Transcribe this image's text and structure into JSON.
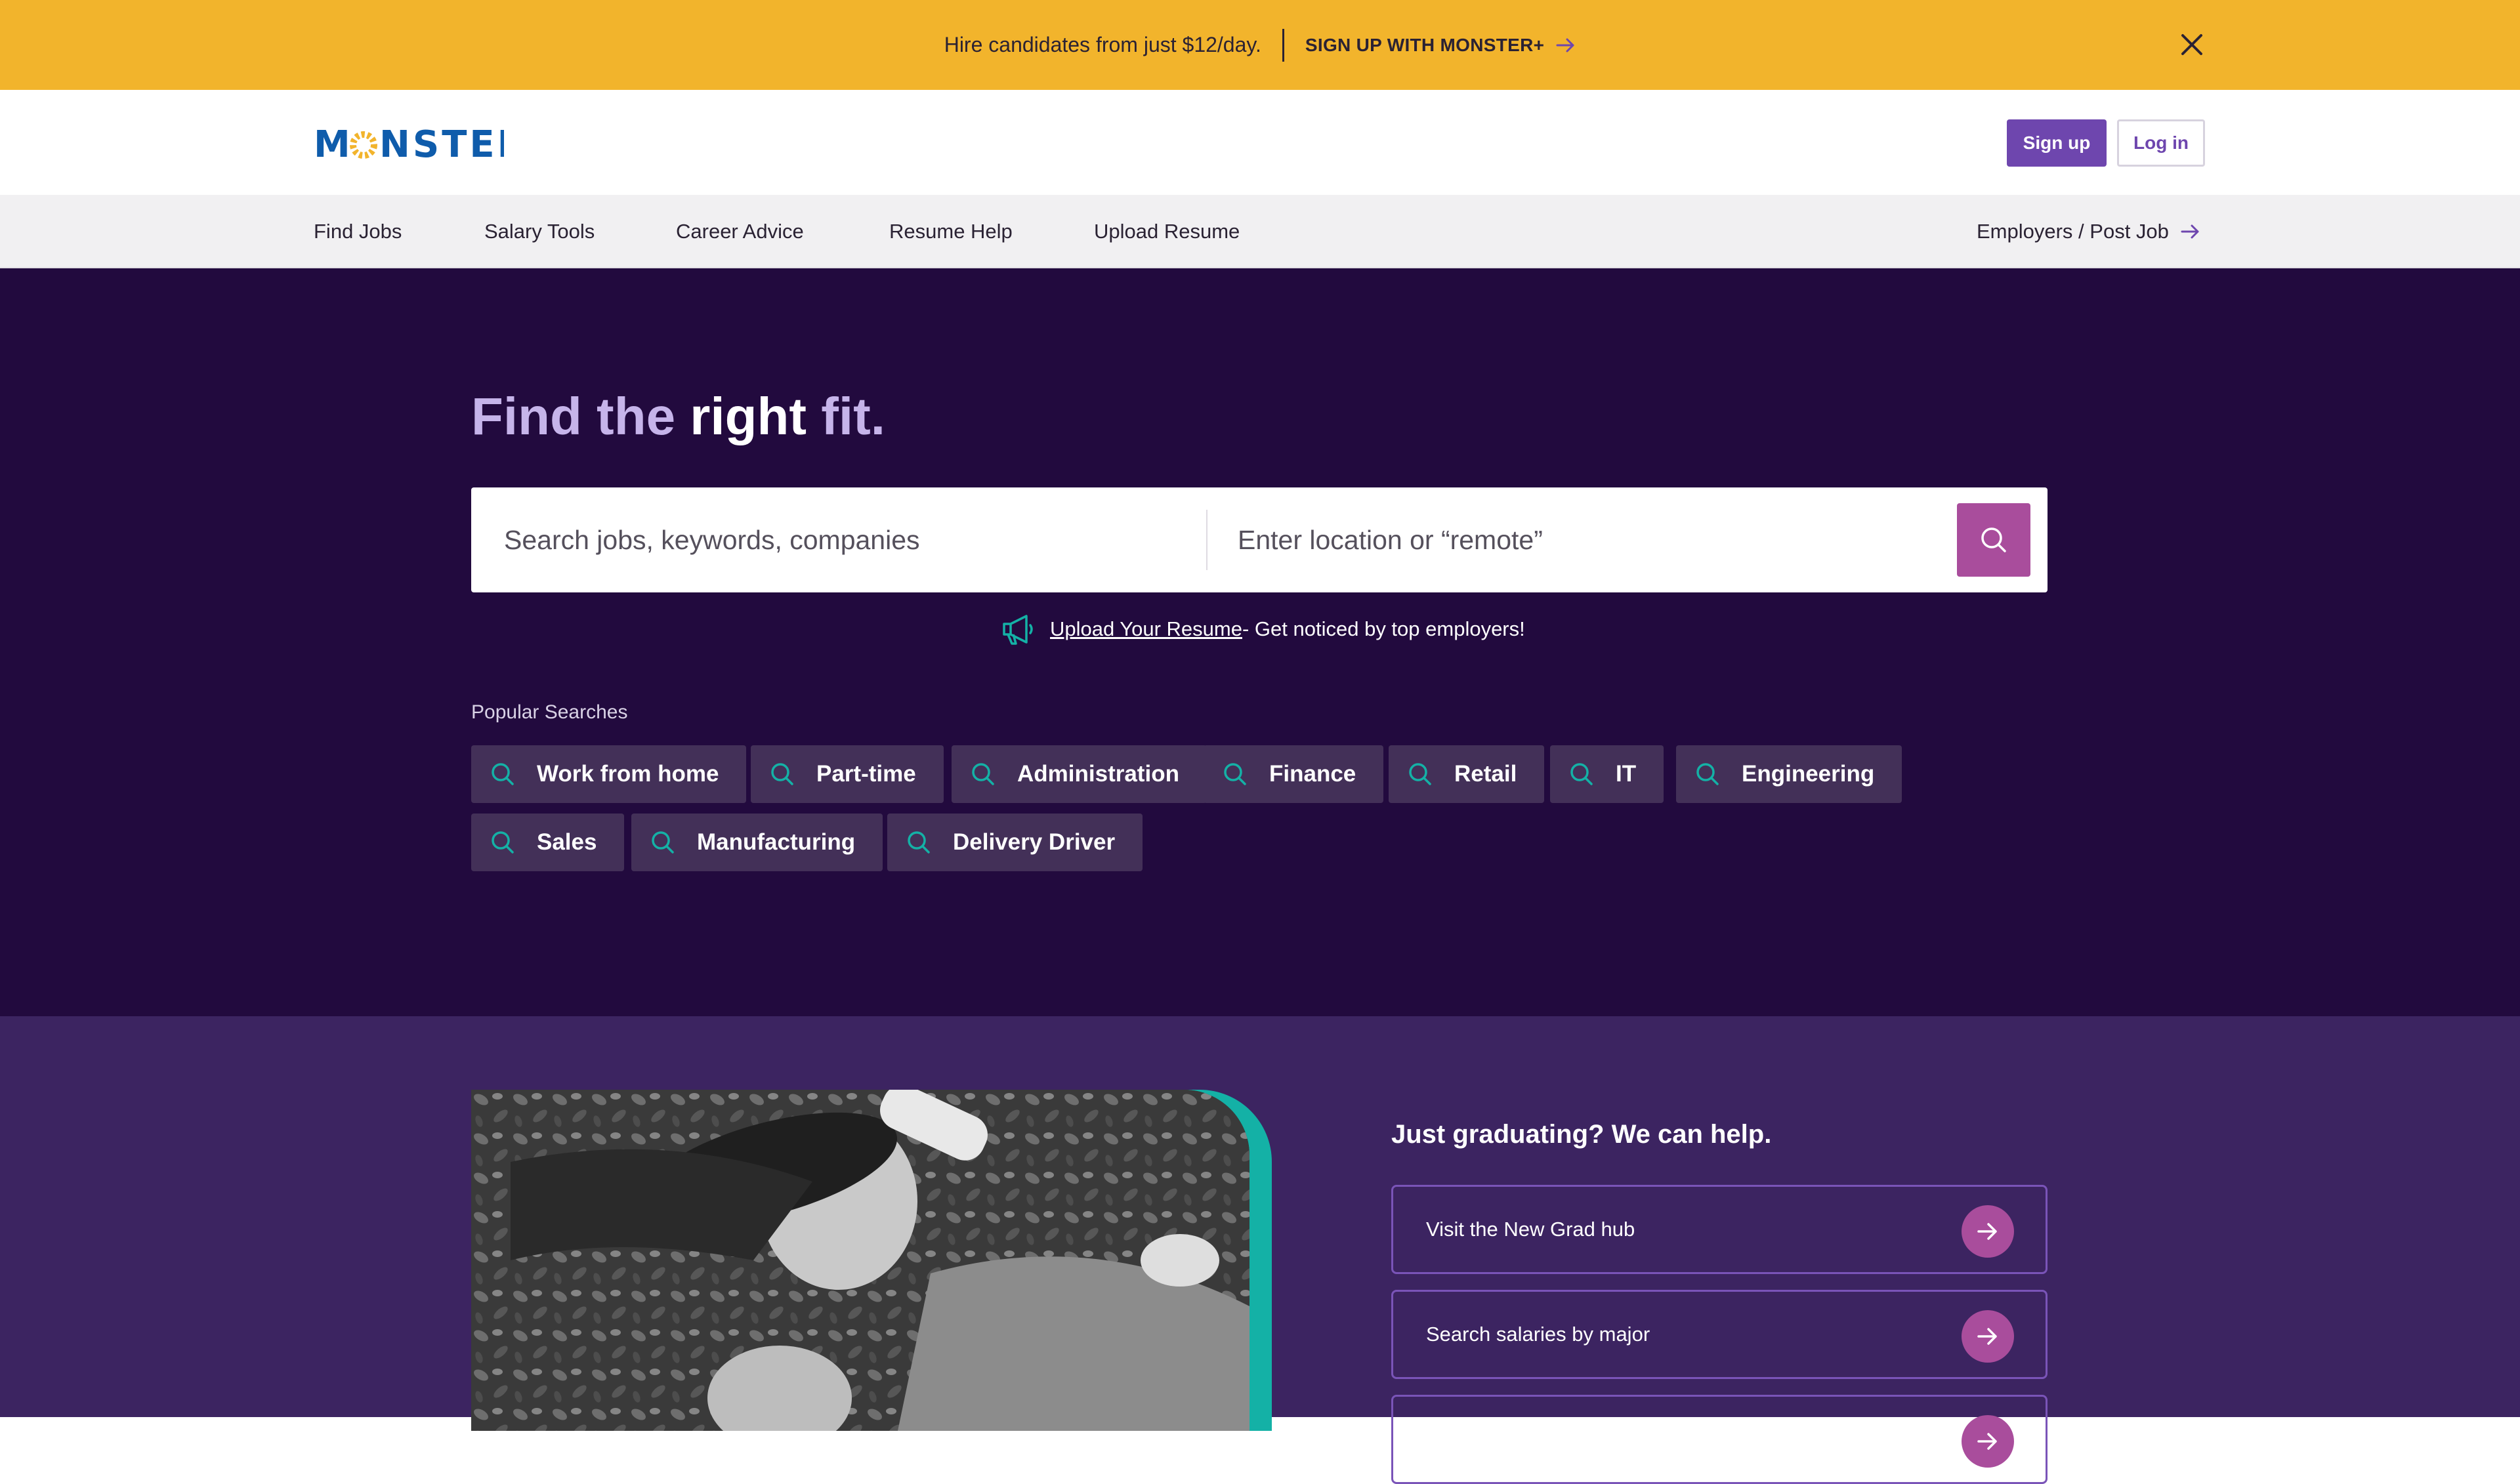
{
  "promo": {
    "text": "Hire candidates from just $12/day.",
    "cta": "SIGN UP WITH MONSTER+"
  },
  "header": {
    "logo": "MONSTER",
    "signup": "Sign up",
    "login": "Log in"
  },
  "nav": {
    "items": [
      "Find Jobs",
      "Salary Tools",
      "Career Advice",
      "Resume Help",
      "Upload Resume"
    ],
    "employers": "Employers / Post Job"
  },
  "hero": {
    "title_part1": "Find the ",
    "title_part2": "right",
    "title_part3": " fit.",
    "search_placeholder": "Search jobs, keywords, companies",
    "location_placeholder": "Enter location or “remote”",
    "upload_link": "Upload Your Resume",
    "upload_rest": " - Get noticed by top employers!",
    "popular_label": "Popular Searches",
    "popular": [
      "Work from home",
      "Part-time",
      "Administration",
      "Finance",
      "Retail",
      "IT",
      "Engineering",
      "Sales",
      "Manufacturing",
      "Delivery Driver"
    ]
  },
  "grad": {
    "title": "Just graduating? We can help.",
    "links": [
      "Visit the New Grad hub",
      "Search salaries by major",
      ""
    ]
  },
  "colors": {
    "promo_bg": "#f2b42c",
    "brand_purple": "#6e46ae",
    "hero_bg": "#220a3e",
    "grad_bg": "#3c2461",
    "accent_magenta": "#a94d9c",
    "accent_teal": "#14b1a6"
  },
  "icons": [
    "arrow-right-icon",
    "close-icon",
    "search-icon",
    "megaphone-icon"
  ]
}
